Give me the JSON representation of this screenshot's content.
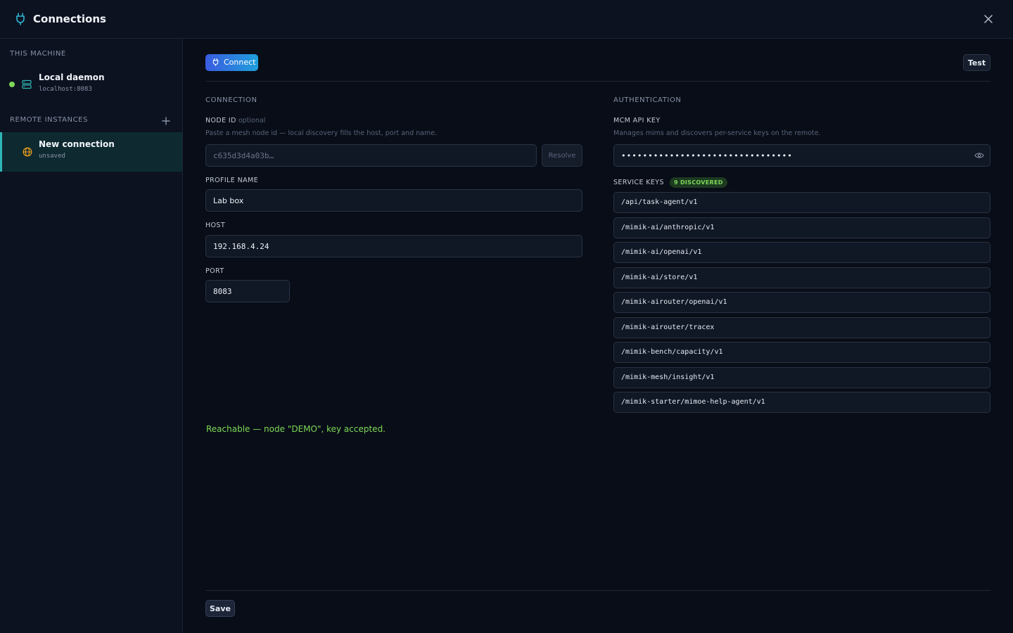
{
  "header": {
    "title": "Connections",
    "icons": {
      "app": "plug-icon",
      "close": "close-icon"
    }
  },
  "sidebar": {
    "this_machine_label": "THIS MACHINE",
    "local": {
      "name": "Local daemon",
      "sub": "localhost:8083",
      "status_color": "#7ed957",
      "icon": "server-icon"
    },
    "remote_label": "REMOTE INSTANCES",
    "add_icon": "plus-icon",
    "remote_items": [
      {
        "name": "New connection",
        "sub": "unsaved",
        "icon": "globe-icon",
        "icon_color": "#f0a020"
      }
    ]
  },
  "toolbar": {
    "connect_label": "Connect",
    "test_label": "Test"
  },
  "connection": {
    "title": "CONNECTION",
    "node_id": {
      "label": "NODE ID",
      "optional": "optional",
      "hint": "Paste a mesh node id — local discovery fills the host, port and name.",
      "placeholder": "c635d3d4a03b…",
      "resolve_label": "Resolve"
    },
    "profile_name": {
      "label": "PROFILE NAME",
      "value": "Lab box"
    },
    "host": {
      "label": "HOST",
      "value": "192.168.4.24"
    },
    "port": {
      "label": "PORT",
      "value": "8083"
    }
  },
  "auth": {
    "title": "AUTHENTICATION",
    "mcm_key": {
      "label": "MCM API KEY",
      "hint": "Manages mims and discovers per-service keys on the remote.",
      "value": "••••••••••••••••••••••••••••••••",
      "icon": "eye-icon"
    },
    "service_keys": {
      "label": "SERVICE KEYS",
      "badge": "9 DISCOVERED",
      "items": [
        "/api/task-agent/v1",
        "/mimik-ai/anthropic/v1",
        "/mimik-ai/openai/v1",
        "/mimik-ai/store/v1",
        "/mimik-airouter/openai/v1",
        "/mimik-airouter/tracex",
        "/mimik-bench/capacity/v1",
        "/mimik-mesh/insight/v1",
        "/mimik-starter/mimoe-help-agent/v1"
      ]
    }
  },
  "status": {
    "message": "Reachable — node \"DEMO\", key accepted.",
    "color": "#7ed957"
  },
  "footer": {
    "save_label": "Save"
  }
}
